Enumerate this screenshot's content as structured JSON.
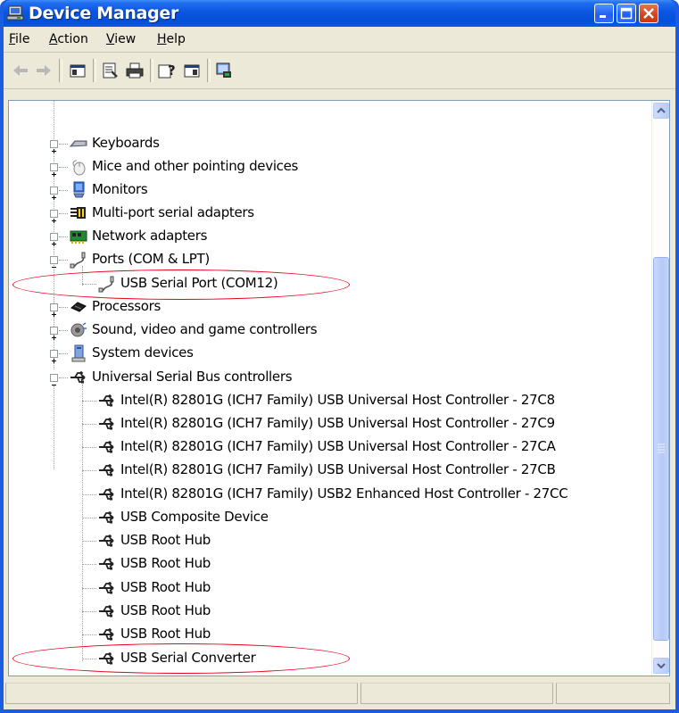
{
  "window": {
    "title": "Device Manager"
  },
  "menu": [
    {
      "label_ul": "F",
      "label_rest": "ile"
    },
    {
      "label_ul": "A",
      "label_rest": "ction"
    },
    {
      "label_ul": "V",
      "label_rest": "iew"
    },
    {
      "label_ul": "H",
      "label_rest": "elp"
    }
  ],
  "toolbar_icons": [
    "back-arrow-icon",
    "forward-arrow-icon",
    "show-hide-console-tree-icon",
    "properties-icon",
    "print-icon",
    "help-icon",
    "description-bar-icon",
    "scan-hardware-icon"
  ],
  "tree": {
    "categories": {
      "keyboards": "Keyboards",
      "mice": "Mice and other pointing devices",
      "monitors": "Monitors",
      "multiport": "Multi-port serial adapters",
      "network": "Network adapters",
      "ports": "Ports (COM & LPT)",
      "processors": "Processors",
      "sound": "Sound, video and game controllers",
      "system": "System devices",
      "usb": "Universal Serial Bus controllers"
    },
    "ports_children": [
      "USB Serial Port (COM12)"
    ],
    "usb_children": [
      "Intel(R) 82801G (ICH7 Family) USB Universal Host Controller - 27C8",
      "Intel(R) 82801G (ICH7 Family) USB Universal Host Controller - 27C9",
      "Intel(R) 82801G (ICH7 Family) USB Universal Host Controller - 27CA",
      "Intel(R) 82801G (ICH7 Family) USB Universal Host Controller - 27CB",
      "Intel(R) 82801G (ICH7 Family) USB2 Enhanced Host Controller - 27CC",
      "USB Composite Device",
      "USB Root Hub",
      "USB Root Hub",
      "USB Root Hub",
      "USB Root Hub",
      "USB Root Hub",
      "USB Serial Converter"
    ]
  },
  "colors": {
    "titlebar": "#0a56e0",
    "highlight_oval": "#e8001c",
    "chrome": "#ece9d8"
  }
}
